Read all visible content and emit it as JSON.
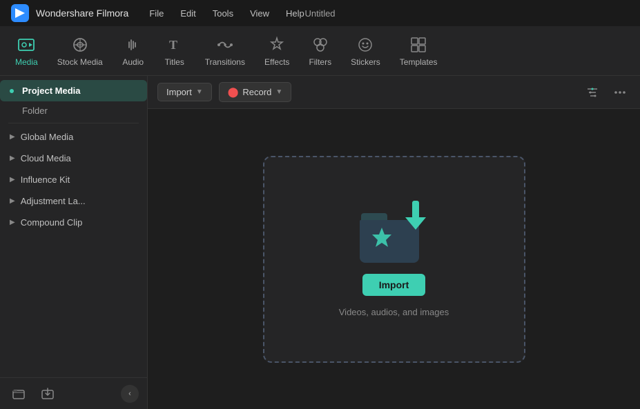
{
  "titleBar": {
    "appName": "Wondershare Filmora",
    "menu": [
      "File",
      "Edit",
      "Tools",
      "View",
      "Help"
    ],
    "windowTitle": "Untitled"
  },
  "toolbar": {
    "items": [
      {
        "label": "Media",
        "icon": "media",
        "active": true
      },
      {
        "label": "Stock Media",
        "icon": "stock"
      },
      {
        "label": "Audio",
        "icon": "audio"
      },
      {
        "label": "Titles",
        "icon": "titles"
      },
      {
        "label": "Transitions",
        "icon": "transitions"
      },
      {
        "label": "Effects",
        "icon": "effects"
      },
      {
        "label": "Filters",
        "icon": "filters"
      },
      {
        "label": "Stickers",
        "icon": "stickers"
      },
      {
        "label": "Templates",
        "icon": "templates"
      }
    ]
  },
  "sidebar": {
    "items": [
      {
        "label": "Project Media",
        "active": true,
        "expanded": true
      },
      {
        "label": "Folder",
        "subItem": true
      },
      {
        "label": "Global Media",
        "active": false
      },
      {
        "label": "Cloud Media",
        "active": false
      },
      {
        "label": "Influence Kit",
        "active": false
      },
      {
        "label": "Adjustment La...",
        "active": false
      },
      {
        "label": "Compound Clip",
        "active": false
      }
    ],
    "footer": {
      "newFolderLabel": "new folder",
      "importLabel": "import",
      "collapseLabel": "collapse"
    }
  },
  "contentToolbar": {
    "importLabel": "Import",
    "recordLabel": "Record",
    "filterIcon": "filter",
    "moreIcon": "more"
  },
  "dropZone": {
    "importBtnLabel": "Import",
    "description": "Videos, audios, and images"
  }
}
